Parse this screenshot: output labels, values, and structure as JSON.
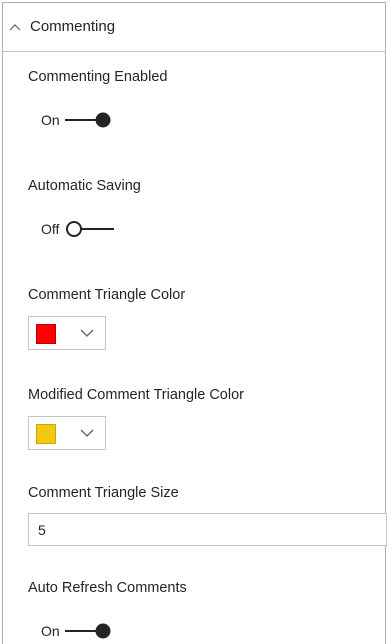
{
  "header": {
    "title": "Commenting",
    "icon": "chevron-up-icon"
  },
  "commenting_enabled": {
    "label": "Commenting Enabled",
    "state": "On",
    "on": true
  },
  "automatic_saving": {
    "label": "Automatic Saving",
    "state": "Off",
    "on": false
  },
  "comment_triangle_color": {
    "label": "Comment Triangle Color",
    "color": "#ff0000"
  },
  "modified_comment_triangle_color": {
    "label": "Modified Comment Triangle Color",
    "color": "#f2c811"
  },
  "comment_triangle_size": {
    "label": "Comment Triangle Size",
    "value": "5"
  },
  "auto_refresh_comments": {
    "label": "Auto Refresh Comments",
    "state": "On",
    "on": true
  }
}
